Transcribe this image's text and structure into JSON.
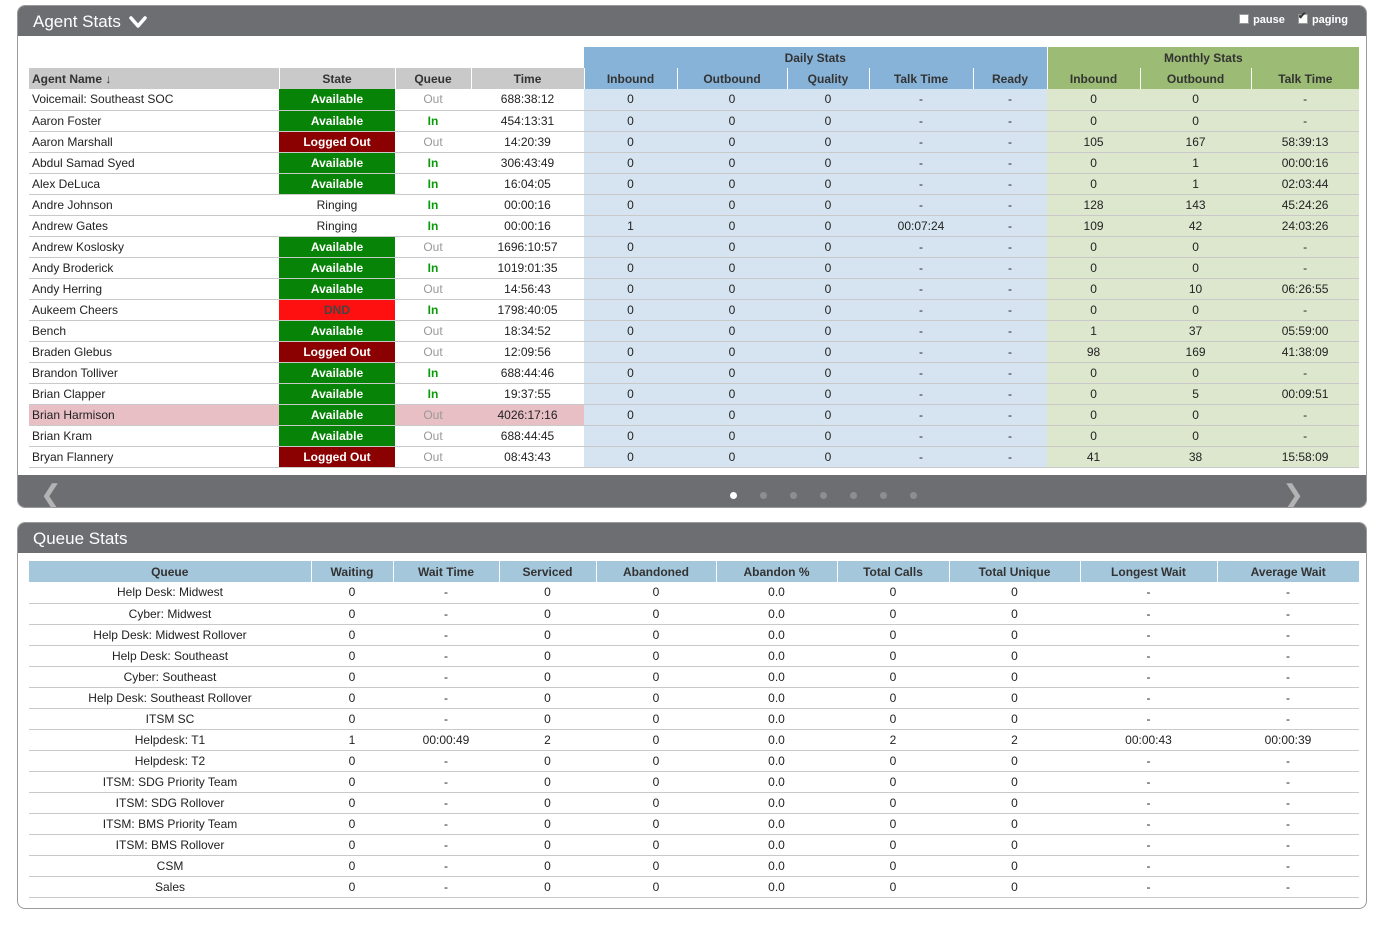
{
  "agent_panel": {
    "title": "Agent Stats",
    "pause_label": "pause",
    "pause_checked": false,
    "paging_label": "paging",
    "paging_checked": true,
    "group_headers": {
      "daily": "Daily Stats",
      "monthly": "Monthly Stats"
    },
    "columns": {
      "agent_name": "Agent Name ↓",
      "state": "State",
      "queue": "Queue",
      "time": "Time",
      "daily_inbound": "Inbound",
      "daily_outbound": "Outbound",
      "daily_quality": "Quality",
      "daily_talk_time": "Talk Time",
      "daily_ready": "Ready",
      "monthly_inbound": "Inbound",
      "monthly_outbound": "Outbound",
      "monthly_talk_time": "Talk Time"
    },
    "rows": [
      [
        "Voicemail: Southeast SOC",
        "Available",
        "Out",
        "688:38:12",
        "0",
        "0",
        "0",
        "-",
        "-",
        "0",
        "0",
        "-"
      ],
      [
        "Aaron Foster",
        "Available",
        "In",
        "454:13:31",
        "0",
        "0",
        "0",
        "-",
        "-",
        "0",
        "0",
        "-"
      ],
      [
        "Aaron Marshall",
        "Logged Out",
        "Out",
        "14:20:39",
        "0",
        "0",
        "0",
        "-",
        "-",
        "105",
        "167",
        "58:39:13"
      ],
      [
        "Abdul Samad Syed",
        "Available",
        "In",
        "306:43:49",
        "0",
        "0",
        "0",
        "-",
        "-",
        "0",
        "1",
        "00:00:16"
      ],
      [
        "Alex DeLuca",
        "Available",
        "In",
        "16:04:05",
        "0",
        "0",
        "0",
        "-",
        "-",
        "0",
        "1",
        "02:03:44"
      ],
      [
        "Andre Johnson",
        "Ringing",
        "In",
        "00:00:16",
        "0",
        "0",
        "0",
        "-",
        "-",
        "128",
        "143",
        "45:24:26"
      ],
      [
        "Andrew Gates",
        "Ringing",
        "In",
        "00:00:16",
        "1",
        "0",
        "0",
        "00:07:24",
        "-",
        "109",
        "42",
        "24:03:26"
      ],
      [
        "Andrew Koslosky",
        "Available",
        "Out",
        "1696:10:57",
        "0",
        "0",
        "0",
        "-",
        "-",
        "0",
        "0",
        "-"
      ],
      [
        "Andy Broderick",
        "Available",
        "In",
        "1019:01:35",
        "0",
        "0",
        "0",
        "-",
        "-",
        "0",
        "0",
        "-"
      ],
      [
        "Andy Herring",
        "Available",
        "Out",
        "14:56:43",
        "0",
        "0",
        "0",
        "-",
        "-",
        "0",
        "10",
        "06:26:55"
      ],
      [
        "Aukeem Cheers",
        "DND",
        "In",
        "1798:40:05",
        "0",
        "0",
        "0",
        "-",
        "-",
        "0",
        "0",
        "-"
      ],
      [
        "Bench",
        "Available",
        "Out",
        "18:34:52",
        "0",
        "0",
        "0",
        "-",
        "-",
        "1",
        "37",
        "05:59:00"
      ],
      [
        "Braden Glebus",
        "Logged Out",
        "Out",
        "12:09:56",
        "0",
        "0",
        "0",
        "-",
        "-",
        "98",
        "169",
        "41:38:09"
      ],
      [
        "Brandon Tolliver",
        "Available",
        "In",
        "688:44:46",
        "0",
        "0",
        "0",
        "-",
        "-",
        "0",
        "0",
        "-"
      ],
      [
        "Brian Clapper",
        "Available",
        "In",
        "19:37:55",
        "0",
        "0",
        "0",
        "-",
        "-",
        "0",
        "5",
        "00:09:51"
      ],
      [
        "Brian Harmison",
        "Available",
        "Out",
        "4026:17:16",
        "0",
        "0",
        "0",
        "-",
        "-",
        "0",
        "0",
        "-"
      ],
      [
        "Brian Kram",
        "Available",
        "Out",
        "688:44:45",
        "0",
        "0",
        "0",
        "-",
        "-",
        "0",
        "0",
        "-"
      ],
      [
        "Bryan Flannery",
        "Logged Out",
        "Out",
        "08:43:43",
        "0",
        "0",
        "0",
        "-",
        "-",
        "41",
        "38",
        "15:58:09"
      ]
    ],
    "highlighted_row": 15,
    "pager": {
      "page_count": 7,
      "current_page": 1,
      "prev_icon": "chevron-left-icon",
      "next_icon": "chevron-right-icon"
    }
  },
  "queue_panel": {
    "title": "Queue Stats",
    "columns": [
      "Queue",
      "Waiting",
      "Wait Time",
      "Serviced",
      "Abandoned",
      "Abandon %",
      "Total Calls",
      "Total Unique",
      "Longest Wait",
      "Average Wait"
    ],
    "rows": [
      [
        "Help Desk: Midwest",
        "0",
        "-",
        "0",
        "0",
        "0.0",
        "0",
        "0",
        "-",
        "-"
      ],
      [
        "Cyber: Midwest",
        "0",
        "-",
        "0",
        "0",
        "0.0",
        "0",
        "0",
        "-",
        "-"
      ],
      [
        "Help Desk: Midwest Rollover",
        "0",
        "-",
        "0",
        "0",
        "0.0",
        "0",
        "0",
        "-",
        "-"
      ],
      [
        "Help Desk: Southeast",
        "0",
        "-",
        "0",
        "0",
        "0.0",
        "0",
        "0",
        "-",
        "-"
      ],
      [
        "Cyber: Southeast",
        "0",
        "-",
        "0",
        "0",
        "0.0",
        "0",
        "0",
        "-",
        "-"
      ],
      [
        "Help Desk: Southeast Rollover",
        "0",
        "-",
        "0",
        "0",
        "0.0",
        "0",
        "0",
        "-",
        "-"
      ],
      [
        "ITSM SC",
        "0",
        "-",
        "0",
        "0",
        "0.0",
        "0",
        "0",
        "-",
        "-"
      ],
      [
        "Helpdesk: T1",
        "1",
        "00:00:49",
        "2",
        "0",
        "0.0",
        "2",
        "2",
        "00:00:43",
        "00:00:39"
      ],
      [
        "Helpdesk: T2",
        "0",
        "-",
        "0",
        "0",
        "0.0",
        "0",
        "0",
        "-",
        "-"
      ],
      [
        "ITSM: SDG Priority Team",
        "0",
        "-",
        "0",
        "0",
        "0.0",
        "0",
        "0",
        "-",
        "-"
      ],
      [
        "ITSM: SDG Rollover",
        "0",
        "-",
        "0",
        "0",
        "0.0",
        "0",
        "0",
        "-",
        "-"
      ],
      [
        "ITSM: BMS Priority Team",
        "0",
        "-",
        "0",
        "0",
        "0.0",
        "0",
        "0",
        "-",
        "-"
      ],
      [
        "ITSM: BMS Rollover",
        "0",
        "-",
        "0",
        "0",
        "0.0",
        "0",
        "0",
        "-",
        "-"
      ],
      [
        "CSM",
        "0",
        "-",
        "0",
        "0",
        "0.0",
        "0",
        "0",
        "-",
        "-"
      ],
      [
        "Sales",
        "0",
        "-",
        "0",
        "0",
        "0.0",
        "0",
        "0",
        "-",
        "-"
      ]
    ]
  },
  "colors": {
    "header_bar": "#6d6e72",
    "available": "#078307",
    "logged_out": "#8b0000",
    "dnd": "#fe1010",
    "queue_in": "#0a9a0a",
    "daily_header": "#87b3d8",
    "monthly_header": "#9cbb74",
    "queue_header": "#a5c7dc"
  }
}
